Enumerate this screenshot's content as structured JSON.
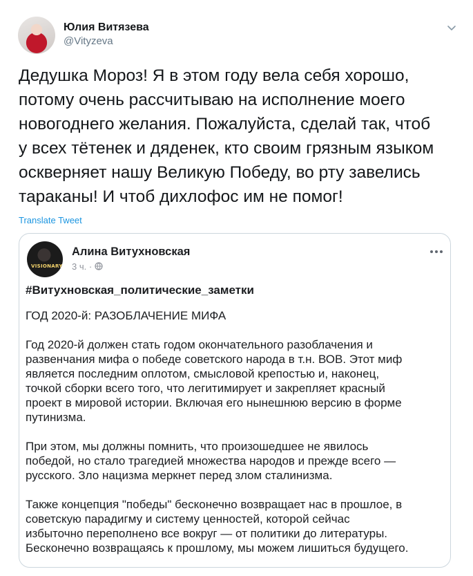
{
  "author": {
    "name": "Юлия Витязева",
    "handle": "@Vityzeva"
  },
  "tweet": {
    "text": "Дедушка Мороз! Я в этом году вела себя хорошо,\nпотому очень рассчитываю на исполнение моего\nновогоднего желания. Пожалуйста, сделай так, чтоб\nу всех тётенек и дяденек, кто своим грязным языком\nоскверняет нашу Великую Победу, во рту завелись\nтараканы! И чтоб дихлофос им не помог!",
    "translate_label": "Translate Tweet"
  },
  "quoted_post": {
    "author_name": "Алина Витухновская",
    "meta": "3 ч. · ",
    "avatar_text": "VISIONARY",
    "hashtag": "#Витухновская_политические_заметки",
    "heading": "ГОД 2020-й: РАЗОБЛАЧЕНИЕ МИФА",
    "paragraphs": [
      "Год 2020-й должен стать годом окончательного разоблачения и\nразвенчания мифа о победе советского народа в т.н. ВОВ. Этот миф\nявляется последним оплотом, смысловой крепостью и, наконец,\nточкой сборки всего того, что легитимирует и закрепляет красный\nпроект в мировой истории. Включая его нынешнюю версию в форме\nпутинизма.",
      "При этом, мы должны помнить, что произошедшее не явилось\nпобедой, но стало трагедией множества народов и прежде всего —\nрусского. Зло нацизма меркнет перед злом сталинизма.",
      "Также концепция \"победы\" бесконечно возвращает нас в прошлое, в\nсоветскую парадигму и систему ценностей, которой сейчас\nизбыточно переполнено все вокруг — от политики до литературы.\nБесконечно возвращаясь к прошлому, мы можем лишиться будущего."
    ]
  },
  "icons": {
    "caret": "chevron-down-icon",
    "more": "more-horizontal-icon",
    "globe": "globe-icon"
  },
  "colors": {
    "link": "#1b95e0",
    "muted": "#657786",
    "border": "#ccd6dd"
  }
}
